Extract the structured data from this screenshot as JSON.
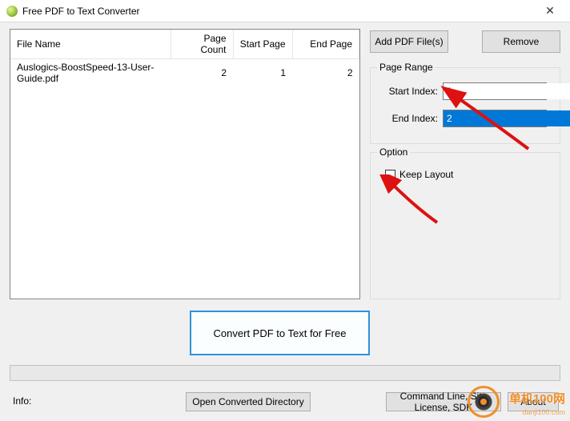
{
  "title": "Free PDF to Text Converter",
  "buttons": {
    "add": "Add PDF File(s)",
    "remove": "Remove",
    "convert": "Convert PDF to Text for Free",
    "open_dir": "Open Converted Directory",
    "cmdline": "Command Line, Site License, SDK",
    "about": "About"
  },
  "filelist": {
    "columns": {
      "name": "File Name",
      "count": "Page Count",
      "start": "Start Page",
      "end": "End Page"
    },
    "rows": [
      {
        "name": "Auslogics-BoostSpeed-13-User-Guide.pdf",
        "count": "2",
        "start": "1",
        "end": "2"
      }
    ]
  },
  "page_range": {
    "legend": "Page Range",
    "start_label": "Start Index:",
    "end_label": "End Index:",
    "start_value": "1",
    "end_value": "2"
  },
  "option": {
    "legend": "Option",
    "keep_layout": "Keep Layout"
  },
  "info_label": "Info:",
  "watermark": {
    "text": "单机100网",
    "sub": "danji100.com"
  }
}
